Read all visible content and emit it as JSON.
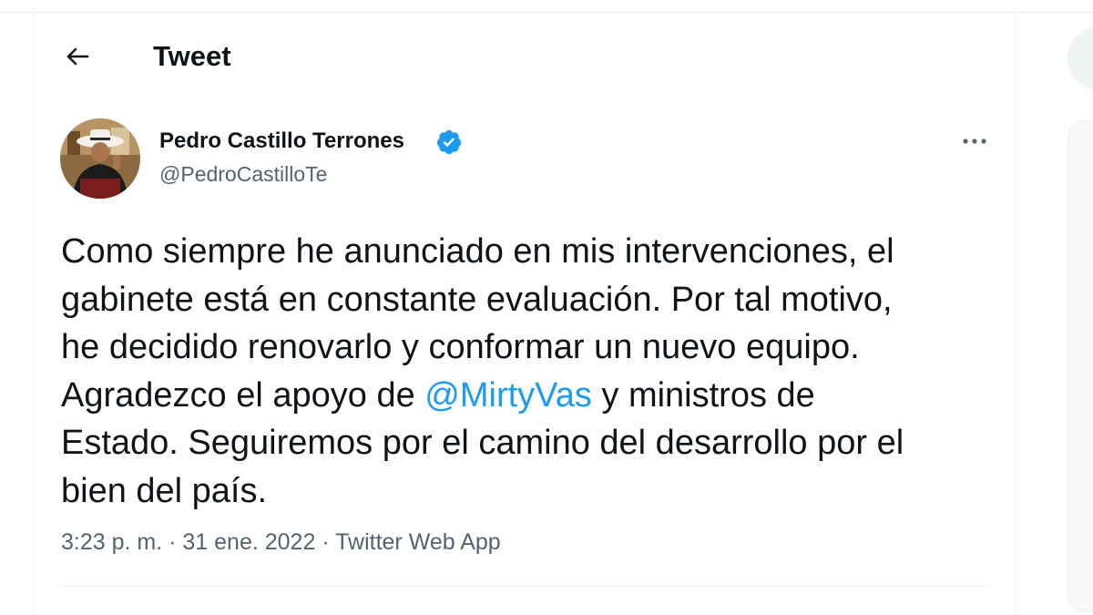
{
  "header": {
    "title": "Tweet",
    "back_icon": "arrow-left-icon"
  },
  "tweet": {
    "author": {
      "name": "Pedro Castillo Terrones",
      "handle": "@PedroCastilloTe",
      "verified": true
    },
    "text": {
      "line1": "Como siempre he anunciado en mis intervenciones, el",
      "line2": "gabinete está en constante evaluación. Por tal motivo,",
      "line3": "he decidido renovarlo y conformar un nuevo equipo.",
      "line4_before": "Agradezco el apoyo de ",
      "mention": "@MirtyVas",
      "line4_after": " y ministros de",
      "line5": "Estado. Seguiremos por el camino del desarrollo por el",
      "line6": "bien del país."
    },
    "meta": {
      "time": "3:23 p. m.",
      "separator": " · ",
      "date": "31 ene. 2022",
      "source": "Twitter Web App"
    }
  },
  "colors": {
    "accent": "#1d9bf0",
    "text_primary": "#0f1419",
    "text_secondary": "#536471",
    "border": "#eff3f4"
  }
}
